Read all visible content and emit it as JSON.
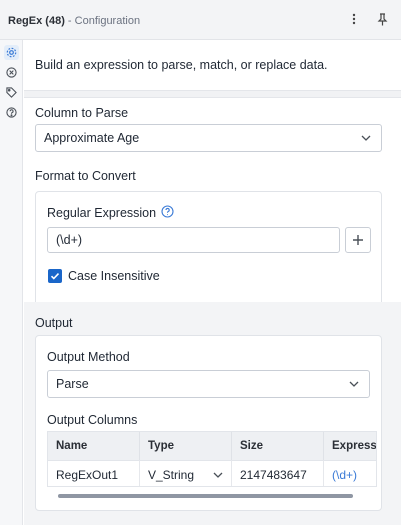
{
  "header": {
    "tool_name": "RegEx (48)",
    "separator": " - ",
    "subtitle": "Configuration",
    "icons": [
      "more-vertical-icon",
      "pin-icon"
    ]
  },
  "rail": {
    "icons": [
      "gear-icon",
      "circle-x-icon",
      "tag-icon",
      "help-icon"
    ]
  },
  "description": "Build an expression to parse, match, or replace data.",
  "column_to_parse": {
    "label": "Column to Parse",
    "value": "Approximate Age"
  },
  "format_to_convert": {
    "label": "Format to Convert",
    "regex_label": "Regular Expression",
    "regex_value": "(\\d+)",
    "case_insensitive_label": "Case Insensitive",
    "case_insensitive_checked": true
  },
  "output": {
    "label": "Output",
    "method_label": "Output Method",
    "method_value": "Parse",
    "columns_label": "Output Columns",
    "table": {
      "headers": [
        "Name",
        "Type",
        "Size",
        "Express"
      ],
      "rows": [
        {
          "name": "RegExOut1",
          "type": "V_String",
          "size": "2147483647",
          "expression": "(\\d+)"
        }
      ]
    }
  },
  "colors": {
    "accent": "#1a66c9",
    "link": "#3a7ad6",
    "rail_active": "#3a7ad6"
  }
}
